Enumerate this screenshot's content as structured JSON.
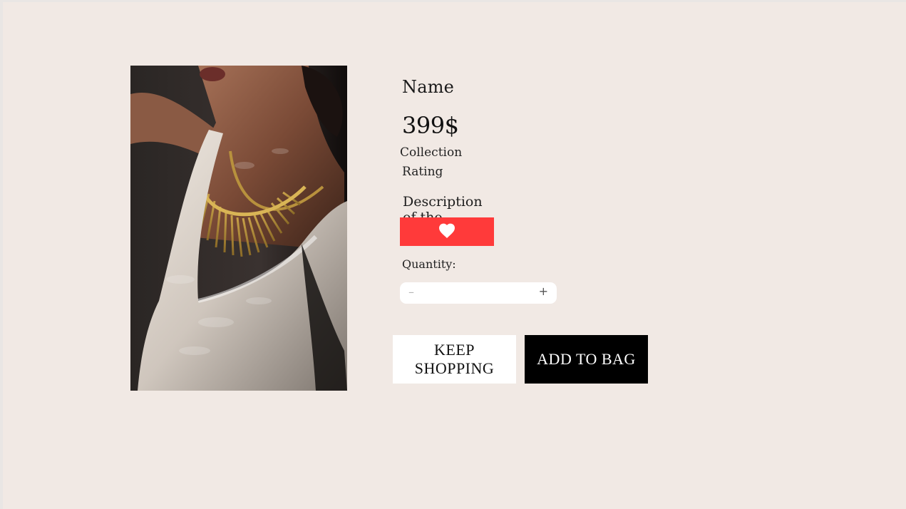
{
  "product": {
    "name": "Name",
    "price": "399$",
    "collection": "Collection",
    "rating": "Rating",
    "description": "Description of the product"
  },
  "favorite": {
    "icon": "heart-icon",
    "color": "#ff3a3a"
  },
  "quantity": {
    "label": "Quantity:",
    "minus": "–",
    "plus": "+",
    "value": ""
  },
  "actions": {
    "keep_shopping": "KEEP SHOPPING",
    "add_to_bag": "ADD TO BAG"
  },
  "colors": {
    "background": "#f1e9e4",
    "accent": "#ff3a3a",
    "primary_button": "#000000"
  }
}
